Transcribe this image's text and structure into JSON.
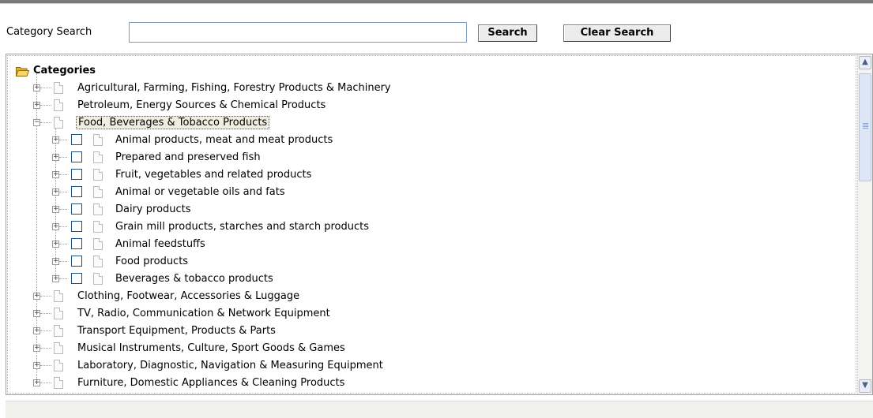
{
  "search": {
    "label": "Category Search",
    "value": "",
    "placeholder": "",
    "search_button": "Search",
    "clear_button": "Clear Search"
  },
  "tree": {
    "root_label": "Categories",
    "items": [
      {
        "label": "Agricultural, Farming, Fishing, Forestry Products & Machinery",
        "expanded": false
      },
      {
        "label": "Petroleum, Energy Sources & Chemical Products",
        "expanded": false
      },
      {
        "label": "Food, Beverages & Tobacco Products",
        "expanded": true,
        "selected": true,
        "children": [
          {
            "label": "Animal products, meat and meat products",
            "checked": false
          },
          {
            "label": "Prepared and preserved fish",
            "checked": false
          },
          {
            "label": "Fruit, vegetables and related products",
            "checked": false
          },
          {
            "label": "Animal or vegetable oils and fats",
            "checked": false
          },
          {
            "label": "Dairy products",
            "checked": false
          },
          {
            "label": "Grain mill products, starches and starch products",
            "checked": false
          },
          {
            "label": "Animal feedstuffs",
            "checked": false
          },
          {
            "label": "Food products",
            "checked": false
          },
          {
            "label": "Beverages & tobacco products",
            "checked": false
          }
        ]
      },
      {
        "label": "Clothing, Footwear, Accessories & Luggage",
        "expanded": false
      },
      {
        "label": "TV, Radio, Communication & Network Equipment",
        "expanded": false
      },
      {
        "label": "Transport Equipment, Products & Parts",
        "expanded": false
      },
      {
        "label": "Musical Instruments, Culture, Sport Goods & Games",
        "expanded": false
      },
      {
        "label": "Laboratory, Diagnostic, Navigation & Measuring Equipment",
        "expanded": false
      },
      {
        "label": "Furniture, Domestic Appliances & Cleaning Products",
        "expanded": false
      }
    ]
  },
  "icons": {
    "root": "folder-open-icon",
    "expand": "plus-expander-icon",
    "collapse": "minus-expander-icon",
    "node": "document-icon",
    "scroll_up": "scroll-up-arrow-icon",
    "scroll_down": "scroll-down-arrow-icon"
  },
  "colors": {
    "folder": "#f3c640",
    "checkbox_border": "#1c5180",
    "scroll_thumb": "#dde6f6"
  }
}
